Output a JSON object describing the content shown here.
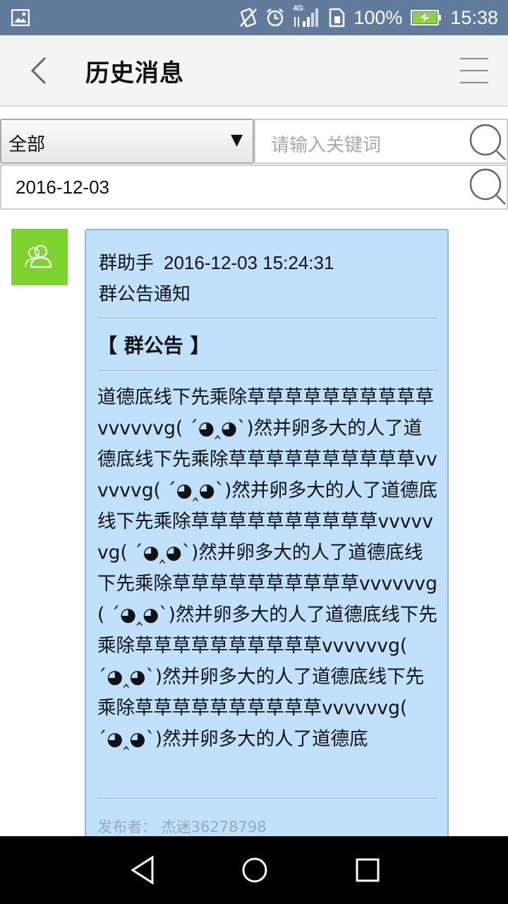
{
  "status_bar": {
    "network": "4G",
    "battery": "100%",
    "time": "15:38"
  },
  "header": {
    "title": "历史消息"
  },
  "filters": {
    "category": "全部",
    "keyword_placeholder": "请输入关键词",
    "date": "2016-12-03"
  },
  "message": {
    "sender": "群助手",
    "timestamp": "2016-12-03 15:24:31",
    "subject": "群公告通知",
    "announcement_title": "【 群公告 】",
    "body": "道德底线下先乘除草草草草草草草草草草vvvvvvg( ´◕‸◕`)然并卵多大的人了道德底线下先乘除草草草草草草草草草草vvvvvvg( ´◕‸◕`)然并卵多大的人了道德底线下先乘除草草草草草草草草草草vvvvvvg( ´◕‸◕`)然并卵多大的人了道德底线下先乘除草草草草草草草草草草vvvvvvg( ´◕‸◕`)然并卵多大的人了道德底线下先乘除草草草草草草草草草草vvvvvvg( ´◕‸◕`)然并卵多大的人了道德底线下先乘除草草草草草草草草草草vvvvvvg( ´◕‸◕`)然并卵多大的人了道德底",
    "publisher": "发布者： 杰迷36278798"
  },
  "colors": {
    "status_bar_bg": "#607b9c",
    "avatar_bg": "#7dd42f",
    "bubble_bg": "#bfe1fb"
  }
}
